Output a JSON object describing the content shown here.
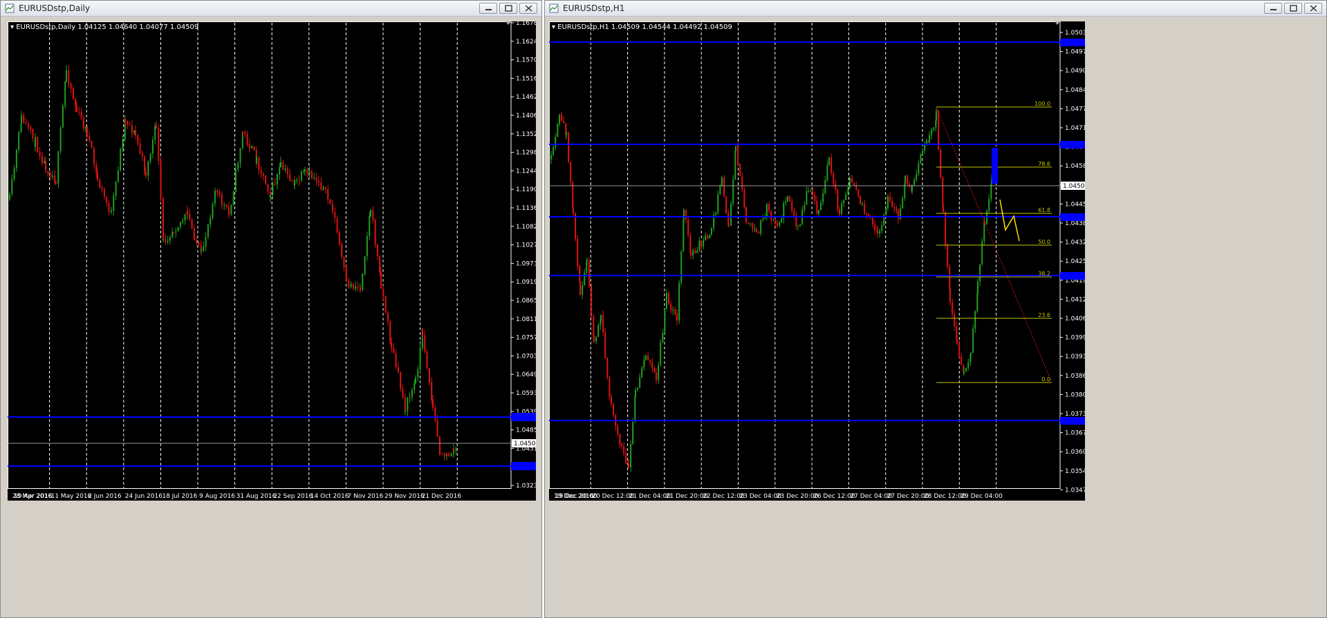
{
  "windows": [
    {
      "title": "EURUSDstp,Daily",
      "header": {
        "symbol": "EURUSDstp,Daily",
        "ohlc": "1.04125 1.04640 1.04077 1.04509"
      },
      "price_axis": [
        "1.16780",
        "1.16240",
        "1.15700",
        "1.15160",
        "1.14620",
        "1.14065",
        "1.13525",
        "1.12985",
        "1.12445",
        "1.11905",
        "1.11365",
        "1.10825",
        "1.10270",
        "1.09730",
        "1.09190",
        "1.08650",
        "1.08110",
        "1.07570",
        "1.07030",
        "1.06490",
        "1.05935",
        "1.05395",
        "1.04855",
        "1.04315",
        "1.03775",
        "1.03235"
      ],
      "time_axis": [
        "28 Mar 2016",
        "19 Apr 2016",
        "11 May 2016",
        "2 Jun 2016",
        "24 Jun 2016",
        "18 Jul 2016",
        "9 Aug 2016",
        "31 Aug 2016",
        "22 Sep 2016",
        "14 Oct 2016",
        "7 Nov 2016",
        "29 Nov 2016",
        "21 Dec 2016"
      ],
      "current_price": "1.04509"
    },
    {
      "title": "EURUSDstp,H1",
      "header": {
        "symbol": "EURUSDstp,H1",
        "ohlc": "1.04509 1.04544 1.04492 1.04509"
      },
      "price_axis": [
        "1.05035",
        "1.04970",
        "1.04905",
        "1.04840",
        "1.04775",
        "1.04710",
        "1.04645",
        "1.04580",
        "1.04515",
        "1.04450",
        "1.04385",
        "1.04320",
        "1.04255",
        "1.04190",
        "1.04125",
        "1.04060",
        "1.03995",
        "1.03930",
        "1.03865",
        "1.03800",
        "1.03735",
        "1.03670",
        "1.03605",
        "1.03540",
        "1.03475"
      ],
      "time_axis": [
        "19 Dec 2016",
        "19 Dec 20:00",
        "20 Dec 12:00",
        "21 Dec 04:00",
        "21 Dec 20:00",
        "22 Dec 12:00",
        "23 Dec 04:00",
        "23 Dec 20:00",
        "26 Dec 12:00",
        "27 Dec 04:00",
        "27 Dec 20:00",
        "28 Dec 12:00",
        "29 Dec 04:00"
      ],
      "current_price": "1.04509",
      "fib_levels": [
        "100.0",
        "78.6",
        "61.8",
        "50.0",
        "38.2",
        "23.6",
        "0.0"
      ]
    }
  ],
  "colors": {
    "bull": "#1fa21f",
    "bear": "#e01414",
    "level_line": "#0000ff",
    "fib": "#c8c800",
    "grid": "#ffffff"
  }
}
